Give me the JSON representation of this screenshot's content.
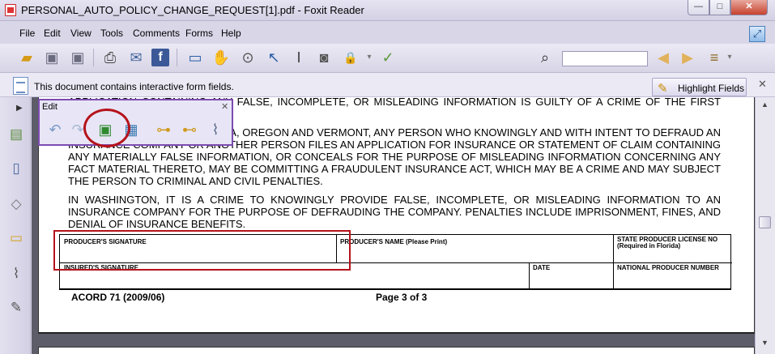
{
  "window": {
    "title": "PERSONAL_AUTO_POLICY_CHANGE_REQUEST[1].pdf - Foxit Reader",
    "minimize": "—",
    "maximize": "□",
    "close": "✕"
  },
  "menu": {
    "items": [
      "File",
      "Edit",
      "View",
      "Tools",
      "Comments",
      "Forms",
      "Help"
    ]
  },
  "infobar": {
    "message": "This document contains interactive form fields.",
    "highlight_label": "Highlight Fields",
    "close": "✕"
  },
  "edit_panel": {
    "title": "Edit",
    "close": "✕"
  },
  "document": {
    "para1": "APPLICATION CONTAINING ANY FALSE, INCOMPLETE, OR MISLEADING INFORMATION IS GUILTY OF A CRIME OF THE FIRST DEGREE.",
    "para2": "IN MAINE, TENNESSEE, VIRGINIA, OREGON AND VERMONT, ANY PERSON WHO KNOWINGLY AND WITH INTENT TO DEFRAUD AN INSURANCE COMPANY OR ANOTHER PERSON FILES AN APPLICATION FOR INSURANCE OR STATEMENT OF CLAIM CONTAINING ANY MATERIALLY FALSE INFORMATION, OR CONCEALS FOR THE PURPOSE OF MISLEADING INFORMATION CONCERNING ANY FACT MATERIAL THERETO, MAY BE COMMITTING A FRAUDULENT INSURANCE ACT, WHICH MAY BE A CRIME AND MAY SUBJECT THE PERSON TO CRIMINAL AND CIVIL PENALTIES.",
    "para3": "IN WASHINGTON, IT IS A CRIME TO KNOWINGLY PROVIDE FALSE, INCOMPLETE, OR MISLEADING INFORMATION TO AN INSURANCE COMPANY FOR THE PURPOSE OF DEFRAUDING THE COMPANY.  PENALTIES INCLUDE IMPRISONMENT, FINES, AND DENIAL OF INSURANCE BENEFITS.",
    "form": {
      "producer_signature": "PRODUCER'S SIGNATURE",
      "producer_name": "PRODUCER'S NAME (Please Print)",
      "state_license_1": "STATE PRODUCER LICENSE NO",
      "state_license_2": "(Required in Florida)",
      "insured_signature": "INSURED'S SIGNATURE",
      "date": "DATE",
      "national_producer": "NATIONAL PRODUCER NUMBER"
    },
    "footer_left": "ACORD 71 (2009/06)",
    "footer_center": "Page 3 of 3"
  },
  "toolbar_search": {
    "value": ""
  }
}
